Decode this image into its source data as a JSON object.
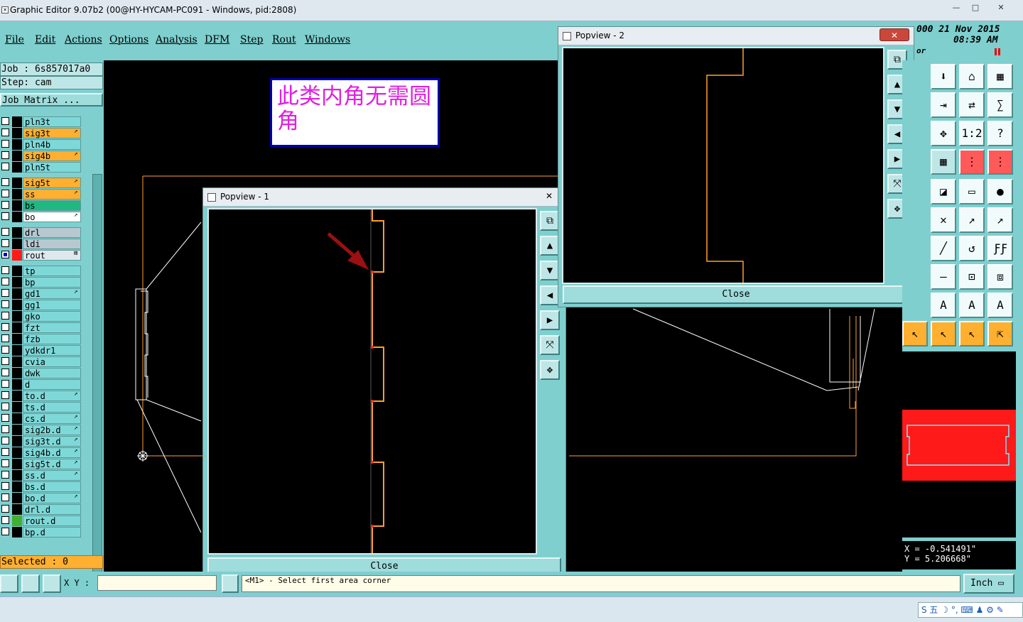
{
  "window": {
    "title": "Graphic Editor 9.07b2 (00@HY-HYCAM-PC091 - Windows, pid:2808)",
    "min": "—",
    "max": "□",
    "close": "✕"
  },
  "menu": [
    "File",
    "Edit",
    "Actions",
    "Options",
    "Analysis",
    "DFM",
    "Step",
    "Rout",
    "Windows"
  ],
  "left": {
    "job": "Job : 6s857017a0",
    "step": "Step: cam",
    "matrix": "Job Matrix ...",
    "selected": "Selected : 0",
    "layers": [
      {
        "name": "pln3t",
        "bg": "#7fd8d8",
        "mark": ""
      },
      {
        "name": "sig3t",
        "bg": "#ffb030",
        "mark": "↗"
      },
      {
        "name": "pln4b",
        "bg": "#7fd8d8",
        "mark": ""
      },
      {
        "name": "sig4b",
        "bg": "#ffb030",
        "mark": "↗"
      },
      {
        "name": "pln5t",
        "bg": "#7fd8d8",
        "mark": ""
      },
      {
        "name": "sig5t",
        "bg": "#ffb030",
        "mark": "↗"
      },
      {
        "name": "ss",
        "bg": "#ffb030",
        "mark": "↗"
      },
      {
        "name": "bs",
        "bg": "#20b880",
        "mark": ""
      },
      {
        "name": "bo",
        "bg": "#ffffff",
        "mark": "↗"
      },
      {
        "name": "drl",
        "bg": "#b8c8d0",
        "mark": ""
      },
      {
        "name": "ldi",
        "bg": "#b8c8d0",
        "mark": ""
      },
      {
        "name": "rout",
        "bg": "#e0e8ec",
        "mark": "⊠"
      },
      {
        "name": "tp",
        "bg": "#7fd8d8",
        "mark": ""
      },
      {
        "name": "bp",
        "bg": "#7fd8d8",
        "mark": ""
      },
      {
        "name": "gd1",
        "bg": "#7fd8d8",
        "mark": "↗"
      },
      {
        "name": "gg1",
        "bg": "#7fd8d8",
        "mark": ""
      },
      {
        "name": "gko",
        "bg": "#7fd8d8",
        "mark": ""
      },
      {
        "name": "fzt",
        "bg": "#7fd8d8",
        "mark": ""
      },
      {
        "name": "fzb",
        "bg": "#7fd8d8",
        "mark": ""
      },
      {
        "name": "ydkdr1",
        "bg": "#7fd8d8",
        "mark": ""
      },
      {
        "name": "cvia",
        "bg": "#7fd8d8",
        "mark": ""
      },
      {
        "name": "dwk",
        "bg": "#7fd8d8",
        "mark": ""
      },
      {
        "name": "d",
        "bg": "#7fd8d8",
        "mark": ""
      },
      {
        "name": "to.d",
        "bg": "#7fd8d8",
        "mark": "↗"
      },
      {
        "name": "ts.d",
        "bg": "#7fd8d8",
        "mark": ""
      },
      {
        "name": "cs.d",
        "bg": "#7fd8d8",
        "mark": "↗"
      },
      {
        "name": "sig2b.d",
        "bg": "#7fd8d8",
        "mark": "↗"
      },
      {
        "name": "sig3t.d",
        "bg": "#7fd8d8",
        "mark": "↗"
      },
      {
        "name": "sig4b.d",
        "bg": "#7fd8d8",
        "mark": "↗"
      },
      {
        "name": "sig5t.d",
        "bg": "#7fd8d8",
        "mark": "↗"
      },
      {
        "name": "ss.d",
        "bg": "#7fd8d8",
        "mark": "↗"
      },
      {
        "name": "bs.d",
        "bg": "#7fd8d8",
        "mark": ""
      },
      {
        "name": "bo.d",
        "bg": "#7fd8d8",
        "mark": "↗"
      },
      {
        "name": "drl.d",
        "bg": "#7fd8d8",
        "mark": ""
      },
      {
        "name": "rout.d",
        "bg": "#7fd8d8",
        "mark": ""
      },
      {
        "name": "bp.d",
        "bg": "#7fd8d8",
        "mark": ""
      }
    ]
  },
  "annotation": "此类内角无需圆角",
  "popview1": {
    "title": "Popview - 1",
    "close_x": "✕",
    "close_label": "Close"
  },
  "popview2": {
    "title": "Popview - 2",
    "close_x": "✕",
    "close_label": "Close"
  },
  "clock": {
    "line1": "000 21 Nov 2015",
    "line2": "08:39 AM",
    "sub": "or"
  },
  "coords": {
    "x": "X = -0.541491\"",
    "y": "Y = 5.206668\""
  },
  "status": {
    "xy_label": "X Y :",
    "prompt": "<M1> - Select first area corner",
    "unit": "Inch ▭"
  },
  "ime": "S 五 ☽ °, ⌨ ♟ ⚙ ✎",
  "colors": {
    "accent": "#7fcfcf",
    "annotation_text": "#e020e0",
    "outline": "#ff9f2f",
    "minimap_red": "#ff1a1a"
  }
}
